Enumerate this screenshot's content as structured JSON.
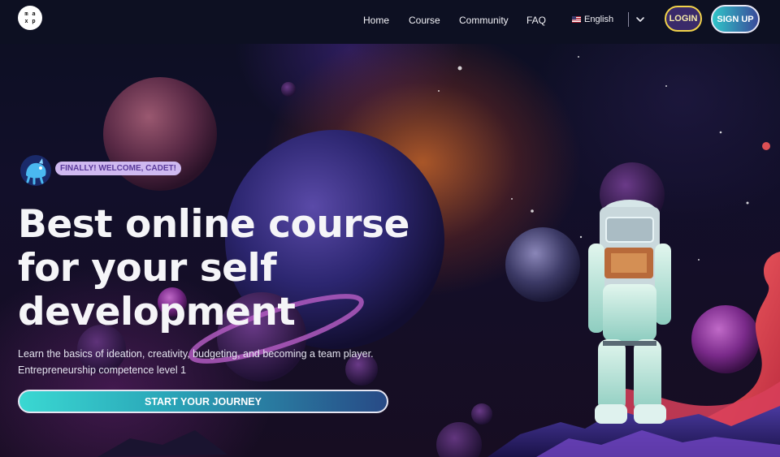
{
  "logo": {
    "letters": [
      "m",
      "a",
      "x",
      "p"
    ]
  },
  "nav": {
    "items": [
      "Home",
      "Course",
      "Community",
      "FAQ"
    ]
  },
  "language": {
    "label": "English",
    "flag": "us-flag-icon"
  },
  "auth": {
    "login_label": "LOGIN",
    "signup_label": "SIGN UP"
  },
  "hero": {
    "badge": "FINALLY! WELCOME, CADET!",
    "headline_lines": [
      "Best online course",
      "for your self",
      "development"
    ],
    "subtext_lines": [
      "Learn the basics of ideation, creativity, budgeting, and becoming a team player.",
      "Entrepreneurship competence level 1"
    ],
    "cta_label": "START YOUR JOURNEY"
  },
  "colors": {
    "login_border": "#f1d24a",
    "signup_gradient_start": "#2fc5c8",
    "cta_gradient_start": "#3ad8d2",
    "badge_bg": "#cfb9f0"
  }
}
